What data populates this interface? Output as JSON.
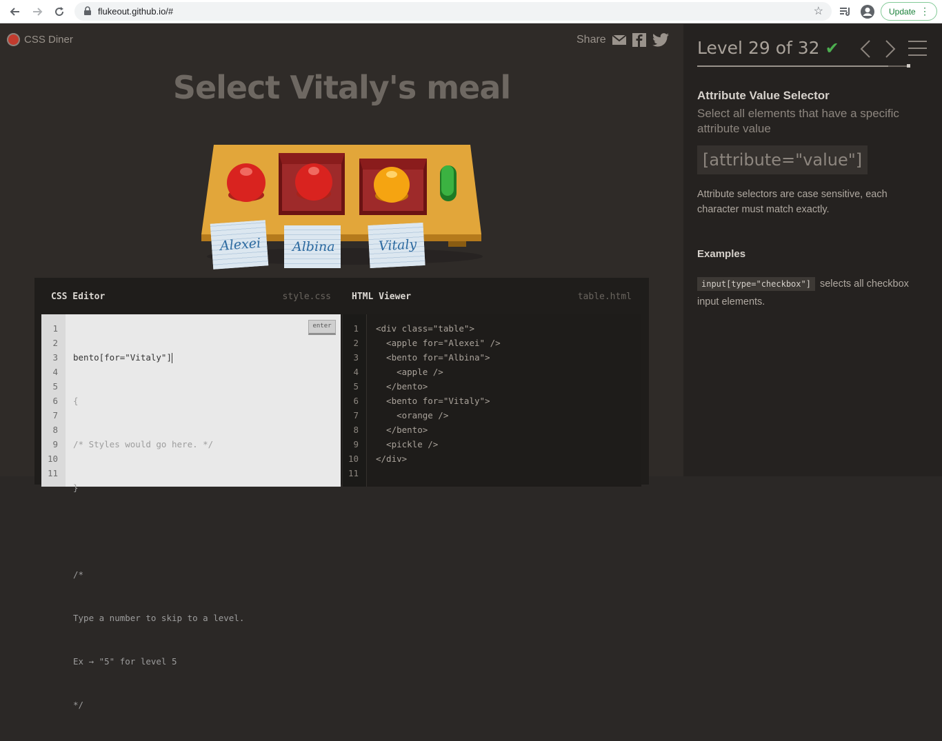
{
  "browser": {
    "url": "flukeout.github.io/#",
    "update_label": "Update"
  },
  "game": {
    "logo": "CSS Diner",
    "share_label": "Share",
    "order": "Select Vitaly's meal",
    "name_tags": [
      "Alexei",
      "Albina",
      "Vitaly"
    ]
  },
  "editor": {
    "css_title": "CSS Editor",
    "css_file": "style.css",
    "enter_label": "enter",
    "css_input": "bento[for=\"Vitaly\"]",
    "css_lines": [
      "{",
      "/* Styles would go here. */",
      "}",
      "",
      "/*",
      "Type a number to skip to a level.",
      "Ex → \"5\" for level 5",
      "*/"
    ],
    "css_line_numbers": "1\n2\n3\n4\n5\n6\n7\n8\n9\n10\n11",
    "html_title": "HTML Viewer",
    "html_file": "table.html",
    "html_code": "<div class=\"table\">\n  <apple for=\"Alexei\" />\n  <bento for=\"Albina\">\n    <apple />\n  </bento>\n  <bento for=\"Vitaly\">\n    <orange />\n  </bento>\n  <pickle />\n</div>",
    "html_line_numbers": "1\n2\n3\n4\n5\n6\n7\n8\n9\n10\n11"
  },
  "sidebar": {
    "level_text": "Level 29 of 32",
    "level_progress": 0.906,
    "selector_name": "Attribute Value Selector",
    "title": "Select all elements that have a specific attribute value",
    "syntax": "[attribute=\"value\"]",
    "hint": "Attribute selectors are case sensitive, each character must match exactly.",
    "examples_title": "Examples",
    "example_code": "input[type=\"checkbox\"]",
    "example_text": "selects all checkbox input elements."
  },
  "colors": {
    "check": "#4cae4f",
    "accent_green": "#188038"
  }
}
